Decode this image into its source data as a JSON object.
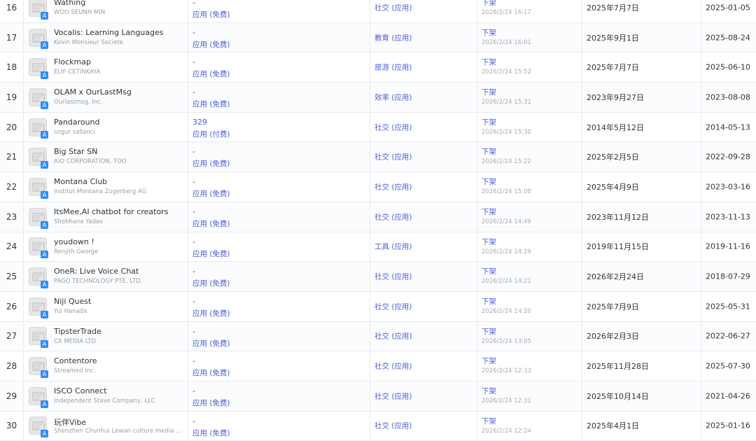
{
  "rows": [
    {
      "num": "16",
      "name": "Wathing",
      "dev": "WOO SEUNH MIN",
      "price": "-",
      "ptype": "应用 (免费)",
      "cat": "社交 (应用)",
      "status": "下架",
      "stime": "2026/2/24 16:17",
      "rel": "2025年7月7日",
      "upd": "2025-01-05"
    },
    {
      "num": "17",
      "name": "Vocalis: Learning Languages",
      "dev": "Kevin Monsieur Societe",
      "price": "-",
      "ptype": "应用 (免费)",
      "cat": "教育 (应用)",
      "status": "下架",
      "stime": "2026/2/24 16:01",
      "rel": "2025年9月1日",
      "upd": "2025-08-24"
    },
    {
      "num": "18",
      "name": "Flockmap",
      "dev": "ELIF CETINKAYA",
      "price": "-",
      "ptype": "应用 (免费)",
      "cat": "旅游 (应用)",
      "status": "下架",
      "stime": "2026/2/24 15:52",
      "rel": "2025年7月7日",
      "upd": "2025-06-10"
    },
    {
      "num": "19",
      "name": "OLAM x OurLastMsg",
      "dev": "Ourlastmsg, Inc.",
      "price": "-",
      "ptype": "应用 (免费)",
      "cat": "效率 (应用)",
      "status": "下架",
      "stime": "2026/2/24 15:31",
      "rel": "2023年9月27日",
      "upd": "2023-08-08"
    },
    {
      "num": "20",
      "name": "Pandaround",
      "dev": "ozgur sallanci",
      "price": "329",
      "ptype": "应用 (付费)",
      "cat": "社交 (应用)",
      "status": "下架",
      "stime": "2026/2/24 15:30",
      "rel": "2014年5月12日",
      "upd": "2014-05-13"
    },
    {
      "num": "21",
      "name": "Big Star SN",
      "dev": "AIO CORPORATION, TOO",
      "price": "-",
      "ptype": "应用 (免费)",
      "cat": "社交 (应用)",
      "status": "下架",
      "stime": "2026/2/24 15:22",
      "rel": "2025年2月5日",
      "upd": "2022-09-28"
    },
    {
      "num": "22",
      "name": "Montana Club",
      "dev": "Institut Montana Zugerberg AG",
      "price": "-",
      "ptype": "应用 (免费)",
      "cat": "社交 (应用)",
      "status": "下架",
      "stime": "2026/2/24 15:08",
      "rel": "2025年4月9日",
      "upd": "2023-03-16"
    },
    {
      "num": "23",
      "name": "ItsMee,AI chatbot for creators",
      "dev": "Shobhana Yadav",
      "price": "-",
      "ptype": "应用 (免费)",
      "cat": "社交 (应用)",
      "status": "下架",
      "stime": "2026/2/24 14:49",
      "rel": "2023年11月12日",
      "upd": "2023-11-13"
    },
    {
      "num": "24",
      "name": "youdown !",
      "dev": "Renjith George",
      "price": "-",
      "ptype": "应用 (免费)",
      "cat": "工具 (应用)",
      "status": "下架",
      "stime": "2026/2/24 14:29",
      "rel": "2019年11月15日",
      "upd": "2019-11-16"
    },
    {
      "num": "25",
      "name": "OneR: Live Voice Chat",
      "dev": "PAGO TECHNOLOGY PTE. LTD.",
      "price": "-",
      "ptype": "应用 (免费)",
      "cat": "社交 (应用)",
      "status": "下架",
      "stime": "2026/2/24 14:21",
      "rel": "2026年2月24日",
      "upd": "2018-07-29"
    },
    {
      "num": "26",
      "name": "Niji Quest",
      "dev": "Yui Hanada",
      "price": "-",
      "ptype": "应用 (免费)",
      "cat": "社交 (应用)",
      "status": "下架",
      "stime": "2026/2/24 14:20",
      "rel": "2025年7月9日",
      "upd": "2025-05-31"
    },
    {
      "num": "27",
      "name": "TipsterTrade",
      "dev": "CX MEDIA LTD",
      "price": "-",
      "ptype": "应用 (免费)",
      "cat": "社交 (应用)",
      "status": "下架",
      "stime": "2026/2/24 13:05",
      "rel": "2026年2月3日",
      "upd": "2022-06-27"
    },
    {
      "num": "28",
      "name": "Contentore",
      "dev": "Streamed Inc.",
      "price": "-",
      "ptype": "应用 (免费)",
      "cat": "社交 (应用)",
      "status": "下架",
      "stime": "2026/2/24 12:33",
      "rel": "2025年11月28日",
      "upd": "2025-07-30"
    },
    {
      "num": "29",
      "name": "ISCO Connect",
      "dev": "Independent Stave Company, LLC",
      "price": "-",
      "ptype": "应用 (免费)",
      "cat": "社交 (应用)",
      "status": "下架",
      "stime": "2026/2/24 12:31",
      "rel": "2025年10月14日",
      "upd": "2021-04-26"
    },
    {
      "num": "30",
      "name": "玩伴Vibe",
      "dev": "Shenzhen Chunhui Lewan culture media Co....",
      "price": "-",
      "ptype": "应用 (免费)",
      "cat": "社交 (应用)",
      "status": "下架",
      "stime": "2026/2/24 12:24",
      "rel": "2025年4月1日",
      "upd": "2025-01-16"
    }
  ],
  "colors": {
    "link": "#4b5fd8",
    "muted": "#9aa0a6",
    "text": "#333333",
    "border": "#e8ebf0",
    "store_badge": "#2f8cff"
  },
  "icons": {
    "placeholder": "app-icon-placeholder",
    "store": "app-store-icon"
  }
}
